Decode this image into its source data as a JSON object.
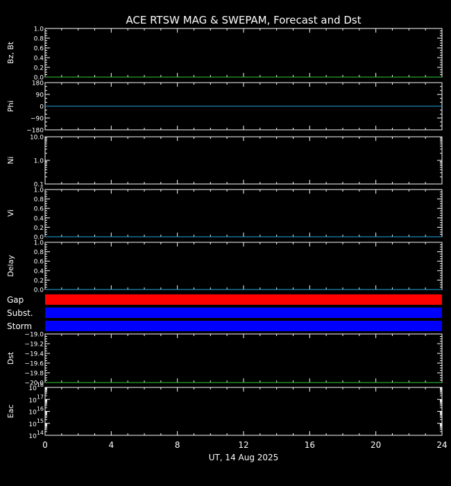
{
  "title": "ACE RTSW MAG & SWEPAM, Forecast and Dst",
  "xlabel": "UT, 14 Aug 2025",
  "chart_data": {
    "type": "line",
    "xlim": [
      0,
      24
    ],
    "x_ticks": [
      "0",
      "4",
      "8",
      "12",
      "16",
      "20",
      "24"
    ],
    "panels": [
      {
        "id": "bz",
        "ylabel": "Bz, Bt",
        "ylim": [
          0.0,
          1.0
        ],
        "scale": "linear",
        "y_ticks": [
          0.0,
          0.2,
          0.4,
          0.6,
          0.8,
          1.0
        ],
        "y_tick_labels": [
          "0.0",
          "0.2",
          "0.4",
          "0.6",
          "0.8",
          "1.0"
        ],
        "minor_step": 0.05,
        "series": [
          {
            "color": "#33cc33",
            "x": [
              0,
              24
            ],
            "y": [
              0.0,
              0.0
            ]
          }
        ]
      },
      {
        "id": "phi",
        "ylabel": "Phi",
        "ylim": [
          -180,
          180
        ],
        "scale": "linear",
        "y_ticks": [
          -180,
          -90,
          0,
          90,
          180
        ],
        "y_tick_labels": [
          "−180",
          "−90",
          "0",
          "90",
          "180"
        ],
        "minor_step": 30,
        "series": [
          {
            "color": "#22aadd",
            "x": [
              0,
              24
            ],
            "y": [
              0,
              0
            ]
          }
        ]
      },
      {
        "id": "ni",
        "ylabel": "Ni",
        "ylim": [
          0.1,
          10.0
        ],
        "scale": "log",
        "y_ticks": [
          0.1,
          1.0,
          10.0
        ],
        "y_tick_labels": [
          "0.1",
          "1.0",
          "10.0"
        ],
        "series": []
      },
      {
        "id": "vi",
        "ylabel": "Vi",
        "ylim": [
          0.0,
          1.0
        ],
        "scale": "linear",
        "y_ticks": [
          0.0,
          0.2,
          0.4,
          0.6,
          0.8,
          1.0
        ],
        "y_tick_labels": [
          "0.0",
          "0.2",
          "0.4",
          "0.6",
          "0.8",
          "1.0"
        ],
        "minor_step": 0.05,
        "series": [
          {
            "color": "#22aadd",
            "x": [
              0,
              24
            ],
            "y": [
              0.0,
              0.0
            ]
          }
        ]
      },
      {
        "id": "delay",
        "ylabel": "Delay",
        "ylim": [
          0.0,
          1.0
        ],
        "scale": "linear",
        "y_ticks": [
          0.0,
          0.2,
          0.4,
          0.6,
          0.8,
          1.0
        ],
        "y_tick_labels": [
          "0.0",
          "0.2",
          "0.4",
          "0.6",
          "0.8",
          "1.0"
        ],
        "minor_step": 0.05,
        "series": [
          {
            "color": "#22aadd",
            "x": [
              0,
              24
            ],
            "y": [
              0.0,
              0.0
            ]
          }
        ]
      },
      {
        "id": "dst",
        "ylabel": "Dst",
        "ylim": [
          -20.0,
          -19.0
        ],
        "scale": "linear",
        "y_ticks": [
          -20.0,
          -19.8,
          -19.6,
          -19.4,
          -19.2,
          -19.0
        ],
        "y_tick_labels": [
          "−20.0",
          "−19.8",
          "−19.6",
          "−19.4",
          "−19.2",
          "−19.0"
        ],
        "minor_step": 0.05,
        "series": [
          {
            "color": "#33cc33",
            "x": [
              0,
              24
            ],
            "y": [
              -20.0,
              -20.0
            ]
          }
        ]
      },
      {
        "id": "eac",
        "ylabel": "Eac",
        "ylim": [
          100000000000000.0,
          1e+18
        ],
        "scale": "log",
        "y_ticks": [
          100000000000000.0,
          1000000000000000.0,
          1e+16,
          1e+17,
          1e+18
        ],
        "y_tick_labels": [
          {
            "base": "10",
            "exp": "14"
          },
          {
            "base": "10",
            "exp": "15"
          },
          {
            "base": "10",
            "exp": "16"
          },
          {
            "base": "10",
            "exp": "17"
          },
          {
            "base": "10",
            "exp": "18"
          }
        ],
        "series": []
      }
    ],
    "bands": [
      {
        "id": "gap",
        "label": "Gap",
        "color": "#ff0000",
        "x": [
          0,
          24
        ]
      },
      {
        "id": "subst",
        "label": "Subst.",
        "color": "#0000ff",
        "x": [
          0,
          24
        ]
      },
      {
        "id": "storm",
        "label": "Storm",
        "color": "#0000ff",
        "x": [
          0,
          24
        ]
      }
    ]
  }
}
